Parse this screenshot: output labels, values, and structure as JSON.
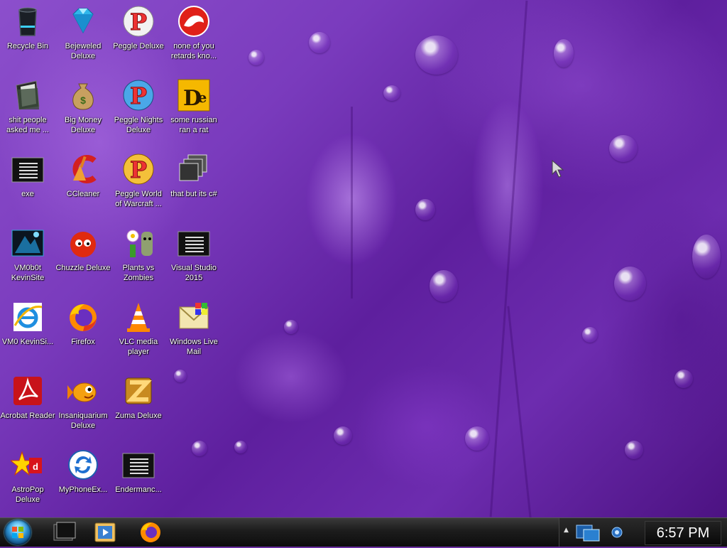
{
  "desktop": {
    "icons": [
      {
        "label": "Recycle Bin",
        "icon": "recycle-bin-icon"
      },
      {
        "label": "shit people asked me ...",
        "icon": "folder-icon"
      },
      {
        "label": "exe",
        "icon": "console-app-icon"
      },
      {
        "label": "VM0b0t KevinSite",
        "icon": "vmobot-icon"
      },
      {
        "label": "VM0 KevinSi...",
        "icon": "internet-explorer-icon"
      },
      {
        "label": "Acrobat Reader",
        "icon": "acrobat-reader-icon"
      },
      {
        "label": "AstroPop Deluxe",
        "icon": "astropop-icon"
      },
      {
        "label": "Bejeweled Deluxe",
        "icon": "bejeweled-gem-icon"
      },
      {
        "label": "Big Money Deluxe",
        "icon": "money-bag-icon"
      },
      {
        "label": "CCleaner",
        "icon": "ccleaner-icon"
      },
      {
        "label": "Chuzzle Deluxe",
        "icon": "chuzzle-icon"
      },
      {
        "label": "Firefox",
        "icon": "firefox-icon"
      },
      {
        "label": "Insaniquarium Deluxe",
        "icon": "goldfish-icon"
      },
      {
        "label": "MyPhoneEx...",
        "icon": "sync-icon"
      },
      {
        "label": "Peggle Deluxe",
        "icon": "peggle-icon"
      },
      {
        "label": "Peggle Nights Deluxe",
        "icon": "peggle-nights-icon"
      },
      {
        "label": "Peggle World of Warcraft ...",
        "icon": "peggle-wow-icon"
      },
      {
        "label": "Plants vs Zombies",
        "icon": "plants-vs-zombies-icon"
      },
      {
        "label": "VLC media player",
        "icon": "vlc-cone-icon"
      },
      {
        "label": "Zuma Deluxe",
        "icon": "zuma-icon"
      },
      {
        "label": "Endermanc...",
        "icon": "console-app-icon"
      },
      {
        "label": "none of you retards kno...",
        "icon": "red-dragon-icon"
      },
      {
        "label": "some russian ran a rat",
        "icon": "de-app-icon"
      },
      {
        "label": "that but its c#",
        "icon": "stacked-windows-icon"
      },
      {
        "label": "Visual Studio 2015",
        "icon": "console-app-icon"
      },
      {
        "label": "Windows Live Mail",
        "icon": "windows-live-mail-icon"
      }
    ]
  },
  "taskbar": {
    "start": "start-orb-icon",
    "pinned": [
      "command-window-icon",
      "media-player-icon",
      "firefox-icon"
    ],
    "tray": {
      "expand": "▲",
      "icons": [
        "network-monitor-icon",
        "volume-icon"
      ],
      "clock": "6:57 PM"
    }
  },
  "colors": {
    "wallpaper": "#6a2fa0",
    "taskbar": "#1c1c1c",
    "label_text": "#ffffff"
  }
}
